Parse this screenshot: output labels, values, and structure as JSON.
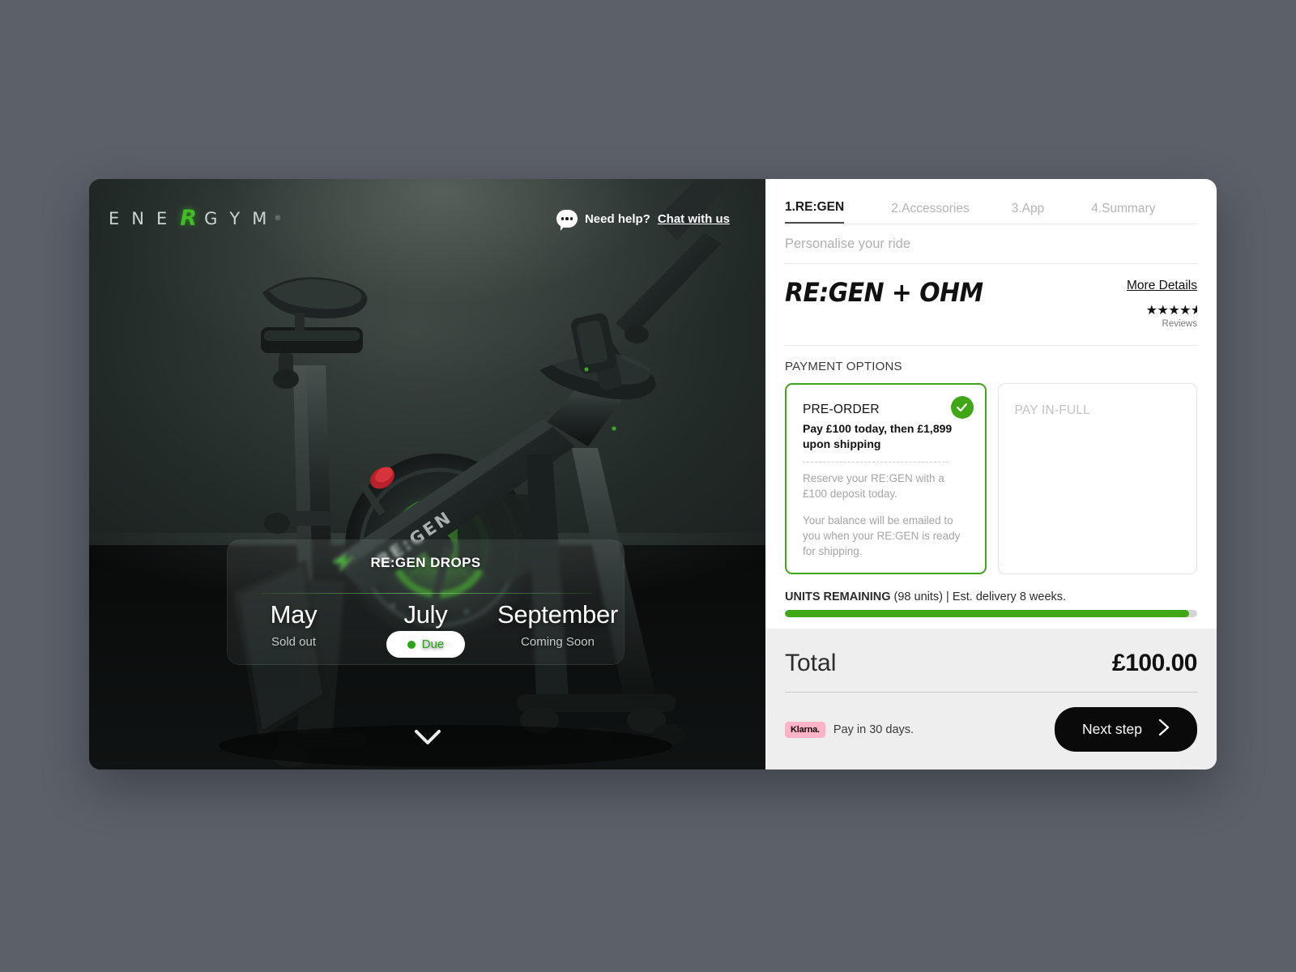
{
  "brand": {
    "logo_letters": [
      "E",
      "N",
      "E",
      "R",
      "G",
      "Y",
      "M"
    ],
    "logo_accent_index": 3,
    "registered_mark": "®",
    "accent_color": "#3fbd23"
  },
  "hero": {
    "help_prompt": "Need help?",
    "help_link": "Chat with us",
    "chat_icon": "chat-bubble-icon",
    "scroll_icon": "chevron-down-icon",
    "drops": {
      "title": "RE:GEN DROPS",
      "items": [
        {
          "month": "May",
          "status": "Sold out",
          "active": false
        },
        {
          "month": "July",
          "status": "Due",
          "active": true
        },
        {
          "month": "September",
          "status": "Coming Soon",
          "active": false
        }
      ]
    }
  },
  "panel": {
    "tabs": [
      {
        "label": "1.RE:GEN",
        "active": true
      },
      {
        "label": "2.Accessories",
        "active": false
      },
      {
        "label": "3.App",
        "active": false
      },
      {
        "label": "4.Summary",
        "active": false
      }
    ],
    "subtitle": "Personalise your ride",
    "product_name": "RE:GEN + OHM",
    "more_details": "More Details",
    "stars": "★★★★",
    "half_star": "★",
    "reviews_label": "Reviews",
    "rating_value": 4.5,
    "payment_options_label": "PAYMENT OPTIONS",
    "payment_options": [
      {
        "title": "PRE-ORDER",
        "subtitle": "Pay £100 today, then £1,899 upon shipping",
        "note_1": "Reserve your RE:GEN with a £100 deposit today.",
        "note_2": "Your balance will be emailed to you when your RE:GEN is ready for shipping.",
        "selected": true,
        "check_icon": "check-icon"
      },
      {
        "title": "PAY IN-FULL",
        "selected": false
      }
    ],
    "units": {
      "label": "UNITS REMAINING",
      "count_text": "(98 units)",
      "separator": "|",
      "delivery_text": "Est. delivery 8 weeks.",
      "full_text": "UNITS REMAINING (98 units) | Est. delivery 8 weeks.",
      "progress_percent": 98,
      "progress_color": "#3fa716"
    },
    "footer": {
      "total_label": "Total",
      "total_value": "£100.00",
      "klarna_badge": "Klarna.",
      "klarna_text": "Pay in 30 days.",
      "next_label": "Next step",
      "next_icon": "chevron-right-icon"
    }
  }
}
